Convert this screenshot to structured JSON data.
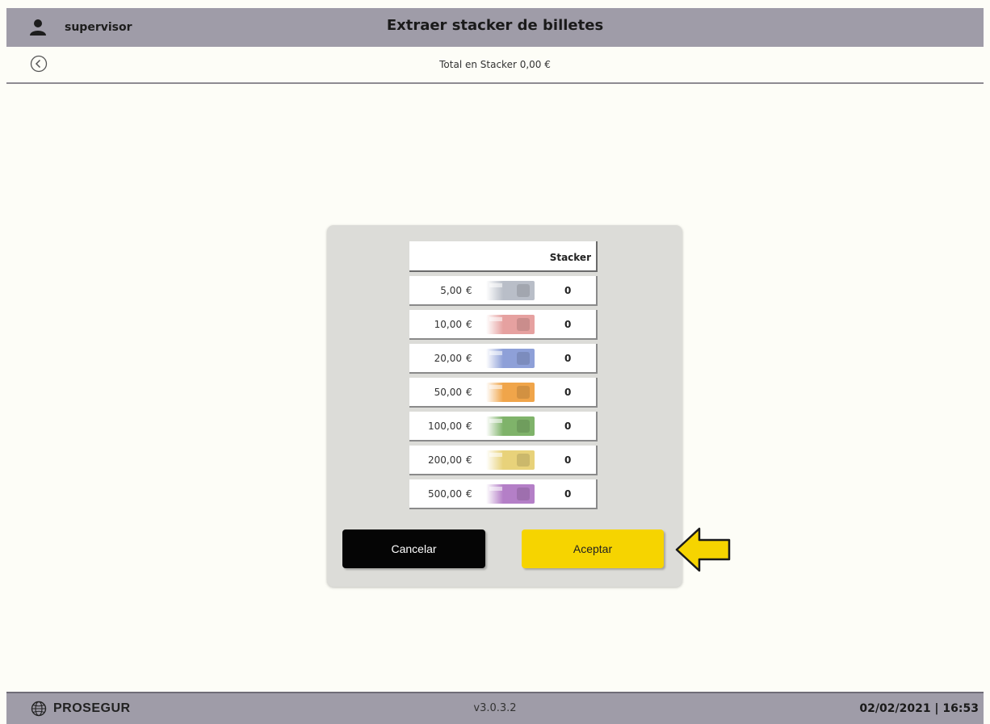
{
  "header": {
    "user": "supervisor",
    "title": "Extraer stacker de billetes",
    "user_icon": "person-icon"
  },
  "subheader": {
    "total_label": "Total en Stacker 0,00 €",
    "back_icon": "back-arrow-icon"
  },
  "table": {
    "column_header": "Stacker",
    "rows": [
      {
        "amount": "5,00",
        "currency": "€",
        "qty": "0",
        "note_color": "#b9bec8"
      },
      {
        "amount": "10,00",
        "currency": "€",
        "qty": "0",
        "note_color": "#e6a1a0"
      },
      {
        "amount": "20,00",
        "currency": "€",
        "qty": "0",
        "note_color": "#8ea0d8"
      },
      {
        "amount": "50,00",
        "currency": "€",
        "qty": "0",
        "note_color": "#f0a54a"
      },
      {
        "amount": "100,00",
        "currency": "€",
        "qty": "0",
        "note_color": "#7fb36a"
      },
      {
        "amount": "200,00",
        "currency": "€",
        "qty": "0",
        "note_color": "#e8d27a"
      },
      {
        "amount": "500,00",
        "currency": "€",
        "qty": "0",
        "note_color": "#b47fc7"
      }
    ]
  },
  "buttons": {
    "cancel": "Cancelar",
    "accept": "Aceptar"
  },
  "footer": {
    "brand": "PROSEGUR",
    "version": "v3.0.3.2",
    "datetime": "02/02/2021 | 16:53"
  },
  "colors": {
    "bar": "#9f9ca8",
    "accept": "#f6d400",
    "cancel": "#050505",
    "arrow": "#f6d400"
  }
}
